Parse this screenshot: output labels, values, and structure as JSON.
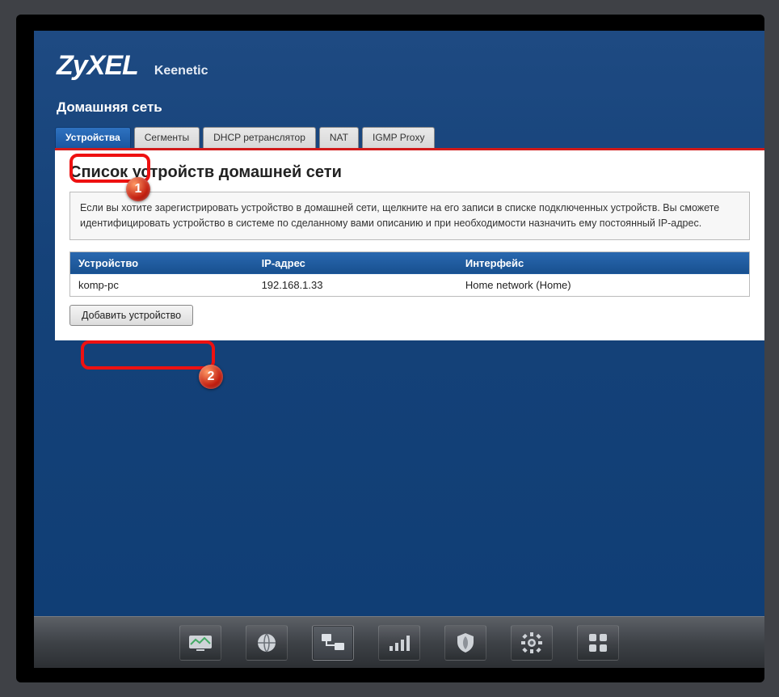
{
  "brand": {
    "logo": "ZyXEL",
    "product": "Keenetic"
  },
  "page": {
    "title": "Домашняя сеть"
  },
  "tabs": [
    {
      "label": "Устройства",
      "active": true
    },
    {
      "label": "Сегменты"
    },
    {
      "label": "DHCP ретранслятор"
    },
    {
      "label": "NAT"
    },
    {
      "label": "IGMP Proxy"
    }
  ],
  "section": {
    "heading": "Список устройств домашней сети",
    "hint": "Если вы хотите зарегистрировать устройство в домашней сети, щелкните на его записи в списке подключенных устройств. Вы сможете идентифицировать устройство в системе по сделанному вами описанию и при необходимости назначить ему постоянный IP-адрес."
  },
  "table": {
    "cols": {
      "device": "Устройство",
      "ip": "IP-адрес",
      "iface": "Интерфейс"
    },
    "rows": [
      {
        "device": "komp-pc",
        "ip": "192.168.1.33",
        "iface": "Home network (Home)"
      }
    ]
  },
  "buttons": {
    "add": "Добавить устройство"
  },
  "markers": {
    "m1": "1",
    "m2": "2"
  }
}
